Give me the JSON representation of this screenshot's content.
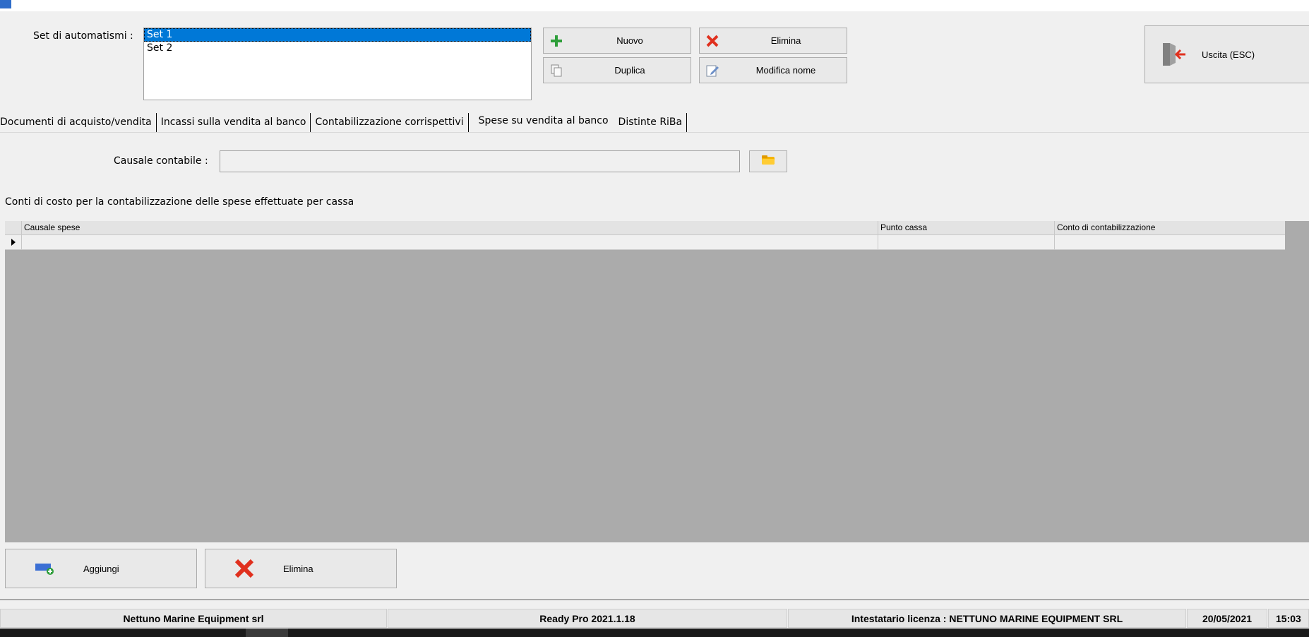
{
  "set_label": "Set di automatismi :",
  "sets": [
    "Set 1",
    "Set 2"
  ],
  "selected_set": "Set 1",
  "buttons": {
    "nuovo": "Nuovo",
    "elimina": "Elimina",
    "duplica": "Duplica",
    "modifica_nome": "Modifica nome",
    "uscita": "Uscita (ESC)"
  },
  "tabs": [
    "Documenti di acquisto/vendita",
    "Incassi sulla vendita al banco",
    "Contabilizzazione corrispettivi",
    "Spese su vendita al banco",
    "Distinte RiBa"
  ],
  "active_tab": "Spese su vendita al banco",
  "causale_label": "Causale contabile :",
  "causale_value": "",
  "section_title": "Conti di costo per la contabilizzazione delle spese effettuate per cassa",
  "grid": {
    "columns": [
      "Causale spese",
      "Punto cassa",
      "Conto di contabilizzazione"
    ]
  },
  "bottom_buttons": {
    "aggiungi": "Aggiungi",
    "elimina": "Elimina"
  },
  "status": {
    "company": "Nettuno Marine Equipment srl",
    "version": "Ready Pro 2021.1.18",
    "license": "Intestatario licenza : NETTUNO MARINE EQUIPMENT SRL",
    "date": "20/05/2021",
    "time": "15:03"
  },
  "colors": {
    "selection": "#0078d7",
    "grid_bg": "#ababab",
    "delete_red": "#e0301e",
    "add_green": "#2e9e3a"
  }
}
